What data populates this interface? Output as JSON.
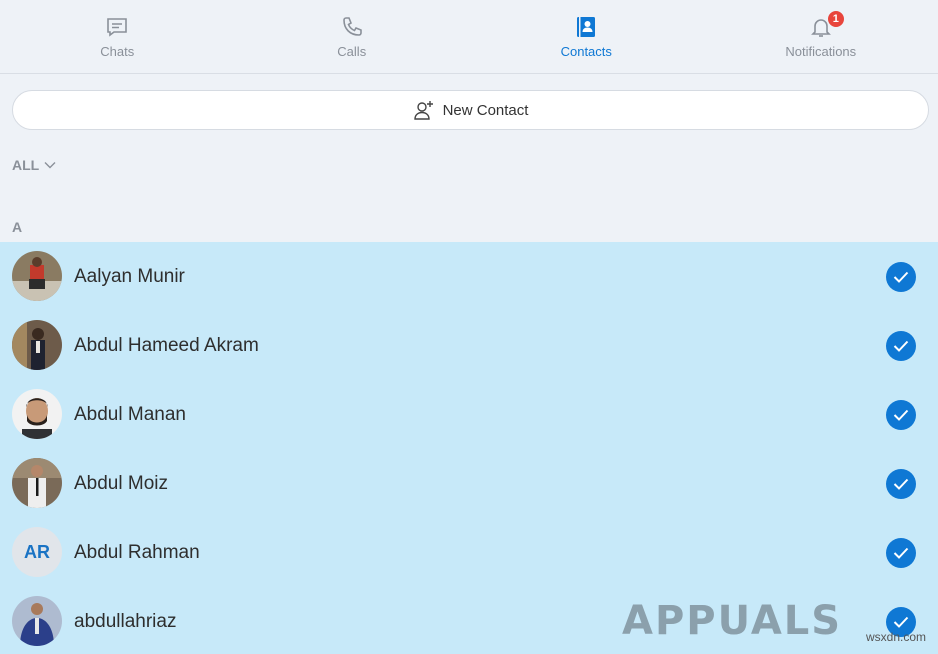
{
  "tabs": [
    {
      "label": "Chats",
      "icon": "chat-icon",
      "active": false
    },
    {
      "label": "Calls",
      "icon": "phone-icon",
      "active": false
    },
    {
      "label": "Contacts",
      "icon": "contacts-icon",
      "active": true
    },
    {
      "label": "Notifications",
      "icon": "bell-icon",
      "active": false,
      "badge": "1"
    }
  ],
  "new_contact": {
    "label": "New Contact",
    "icon": "add-person-icon"
  },
  "filter": {
    "label": "ALL",
    "icon": "chevron-down-icon"
  },
  "section": {
    "letter": "A"
  },
  "contacts": [
    {
      "name": "Aalyan Munir",
      "avatar": "photo",
      "selected": true
    },
    {
      "name": "Abdul Hameed Akram",
      "avatar": "photo",
      "selected": true
    },
    {
      "name": "Abdul Manan",
      "avatar": "photo",
      "selected": true
    },
    {
      "name": "Abdul Moiz",
      "avatar": "photo",
      "selected": true
    },
    {
      "name": "Abdul Rahman",
      "avatar_initials": "AR",
      "selected": true
    },
    {
      "name": "abdullahriaz",
      "avatar": "photo",
      "selected": true
    }
  ],
  "watermark": {
    "brand": "APPUALS",
    "site": "wsxdn.com"
  },
  "colors": {
    "accent": "#0f78d4",
    "selected_row": "#c7e9f9",
    "badge": "#e8453c",
    "background": "#eef2f7"
  }
}
